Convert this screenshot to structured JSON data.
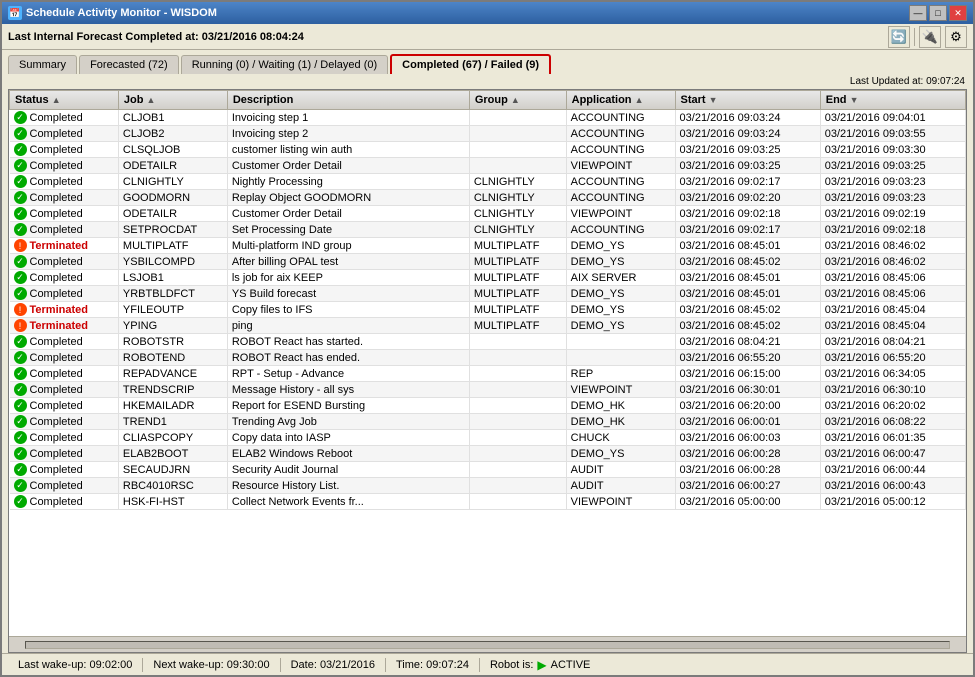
{
  "window": {
    "title": "Schedule Activity Monitor - WISDOM",
    "icon": "📅"
  },
  "title_bar": {
    "minimize": "—",
    "maximize": "□",
    "close": "✕"
  },
  "forecast": {
    "label": "Last Internal Forecast Completed at: 03/21/2016 08:04:24"
  },
  "toolbar": {
    "refresh_icon": "🔄",
    "connect_icon": "🔌",
    "settings_icon": "⚙"
  },
  "tabs": [
    {
      "label": "Summary",
      "active": false
    },
    {
      "label": "Forecasted (72)",
      "active": false
    },
    {
      "label": "Running (0) / Waiting (1) / Delayed (0)",
      "active": false
    },
    {
      "label": "Completed (67) / Failed (9)",
      "active": true
    }
  ],
  "last_updated": "Last Updated at: 09:07:24",
  "table": {
    "columns": [
      {
        "label": "Status",
        "sort": "asc"
      },
      {
        "label": "Job",
        "sort": "asc"
      },
      {
        "label": "Description",
        "sort": ""
      },
      {
        "label": "Group",
        "sort": "asc"
      },
      {
        "label": "Application",
        "sort": "asc"
      },
      {
        "label": "Start",
        "sort": "desc"
      },
      {
        "label": "End",
        "sort": "desc"
      }
    ],
    "rows": [
      {
        "status": "Completed",
        "status_type": "completed",
        "job": "CLJOB1",
        "description": "Invoicing step 1",
        "group": "",
        "application": "ACCOUNTING",
        "start": "03/21/2016 09:03:24",
        "end": "03/21/2016 09:04:01"
      },
      {
        "status": "Completed",
        "status_type": "completed",
        "job": "CLJOB2",
        "description": "Invoicing step 2",
        "group": "",
        "application": "ACCOUNTING",
        "start": "03/21/2016 09:03:24",
        "end": "03/21/2016 09:03:55"
      },
      {
        "status": "Completed",
        "status_type": "completed",
        "job": "CLSQLJOB",
        "description": "customer listing win auth",
        "group": "",
        "application": "ACCOUNTING",
        "start": "03/21/2016 09:03:25",
        "end": "03/21/2016 09:03:30"
      },
      {
        "status": "Completed",
        "status_type": "completed",
        "job": "ODETAILR",
        "description": "Customer Order Detail",
        "group": "",
        "application": "VIEWPOINT",
        "start": "03/21/2016 09:03:25",
        "end": "03/21/2016 09:03:25"
      },
      {
        "status": "Completed",
        "status_type": "completed",
        "job": "CLNIGHTLY",
        "description": "Nightly Processing",
        "group": "CLNIGHTLY",
        "application": "ACCOUNTING",
        "start": "03/21/2016 09:02:17",
        "end": "03/21/2016 09:03:23"
      },
      {
        "status": "Completed",
        "status_type": "completed",
        "job": "GOODMORN",
        "description": "Replay Object GOODMORN",
        "group": "CLNIGHTLY",
        "application": "ACCOUNTING",
        "start": "03/21/2016 09:02:20",
        "end": "03/21/2016 09:03:23"
      },
      {
        "status": "Completed",
        "status_type": "completed",
        "job": "ODETAILR",
        "description": "Customer Order Detail",
        "group": "CLNIGHTLY",
        "application": "VIEWPOINT",
        "start": "03/21/2016 09:02:18",
        "end": "03/21/2016 09:02:19"
      },
      {
        "status": "Completed",
        "status_type": "completed",
        "job": "SETPROCDAT",
        "description": "Set Processing Date",
        "group": "CLNIGHTLY",
        "application": "ACCOUNTING",
        "start": "03/21/2016 09:02:17",
        "end": "03/21/2016 09:02:18"
      },
      {
        "status": "Terminated",
        "status_type": "terminated",
        "job": "MULTIPLATF",
        "description": "Multi-platform IND group",
        "group": "MULTIPLATF",
        "application": "DEMO_YS",
        "start": "03/21/2016 08:45:01",
        "end": "03/21/2016 08:46:02"
      },
      {
        "status": "Completed",
        "status_type": "completed",
        "job": "YSBILCOMPD",
        "description": "After billing OPAL test",
        "group": "MULTIPLATF",
        "application": "DEMO_YS",
        "start": "03/21/2016 08:45:02",
        "end": "03/21/2016 08:46:02"
      },
      {
        "status": "Completed",
        "status_type": "completed",
        "job": "LSJOB1",
        "description": "ls job for aix KEEP",
        "group": "MULTIPLATF",
        "application": "AIX SERVER",
        "start": "03/21/2016 08:45:01",
        "end": "03/21/2016 08:45:06"
      },
      {
        "status": "Completed",
        "status_type": "completed",
        "job": "YRBTBLDFCT",
        "description": "YS Build forecast",
        "group": "MULTIPLATF",
        "application": "DEMO_YS",
        "start": "03/21/2016 08:45:01",
        "end": "03/21/2016 08:45:06"
      },
      {
        "status": "Terminated",
        "status_type": "terminated",
        "job": "YFILEOUTP",
        "description": "Copy files to IFS",
        "group": "MULTIPLATF",
        "application": "DEMO_YS",
        "start": "03/21/2016 08:45:02",
        "end": "03/21/2016 08:45:04"
      },
      {
        "status": "Terminated",
        "status_type": "terminated",
        "job": "YPING",
        "description": "ping",
        "group": "MULTIPLATF",
        "application": "DEMO_YS",
        "start": "03/21/2016 08:45:02",
        "end": "03/21/2016 08:45:04"
      },
      {
        "status": "Completed",
        "status_type": "completed",
        "job": "ROBOTSTR",
        "description": "ROBOT React has started.",
        "group": "",
        "application": "",
        "start": "03/21/2016 08:04:21",
        "end": "03/21/2016 08:04:21"
      },
      {
        "status": "Completed",
        "status_type": "completed",
        "job": "ROBOTEND",
        "description": "ROBOT React has ended.",
        "group": "",
        "application": "",
        "start": "03/21/2016 06:55:20",
        "end": "03/21/2016 06:55:20"
      },
      {
        "status": "Completed",
        "status_type": "completed",
        "job": "REPADVANCE",
        "description": "RPT - Setup - Advance",
        "group": "",
        "application": "REP",
        "start": "03/21/2016 06:15:00",
        "end": "03/21/2016 06:34:05"
      },
      {
        "status": "Completed",
        "status_type": "completed",
        "job": "TRENDSCRIP",
        "description": "Message History - all sys",
        "group": "",
        "application": "VIEWPOINT",
        "start": "03/21/2016 06:30:01",
        "end": "03/21/2016 06:30:10"
      },
      {
        "status": "Completed",
        "status_type": "completed",
        "job": "HKEMAILADR",
        "description": "Report for ESEND Bursting",
        "group": "",
        "application": "DEMO_HK",
        "start": "03/21/2016 06:20:00",
        "end": "03/21/2016 06:20:02"
      },
      {
        "status": "Completed",
        "status_type": "completed",
        "job": "TREND1",
        "description": "Trending Avg Job",
        "group": "",
        "application": "DEMO_HK",
        "start": "03/21/2016 06:00:01",
        "end": "03/21/2016 06:08:22"
      },
      {
        "status": "Completed",
        "status_type": "completed",
        "job": "CLIASPCOPY",
        "description": "Copy data into IASP",
        "group": "",
        "application": "CHUCK",
        "start": "03/21/2016 06:00:03",
        "end": "03/21/2016 06:01:35"
      },
      {
        "status": "Completed",
        "status_type": "completed",
        "job": "ELAB2BOOT",
        "description": "ELAB2 Windows Reboot",
        "group": "",
        "application": "DEMO_YS",
        "start": "03/21/2016 06:00:28",
        "end": "03/21/2016 06:00:47"
      },
      {
        "status": "Completed",
        "status_type": "completed",
        "job": "SECAUDJRN",
        "description": "Security Audit Journal",
        "group": "",
        "application": "AUDIT",
        "start": "03/21/2016 06:00:28",
        "end": "03/21/2016 06:00:44"
      },
      {
        "status": "Completed",
        "status_type": "completed",
        "job": "RBC4010RSC",
        "description": "Resource History List.",
        "group": "",
        "application": "AUDIT",
        "start": "03/21/2016 06:00:27",
        "end": "03/21/2016 06:00:43"
      },
      {
        "status": "Completed",
        "status_type": "completed",
        "job": "HSK-FI-HST",
        "description": "Collect Network Events fr...",
        "group": "",
        "application": "VIEWPOINT",
        "start": "03/21/2016 05:00:00",
        "end": "03/21/2016 05:00:12"
      }
    ]
  },
  "status_bar": {
    "last_wakeup_label": "Last wake-up:",
    "last_wakeup_value": "09:02:00",
    "next_wakeup_label": "Next wake-up:",
    "next_wakeup_value": "09:30:00",
    "date_label": "Date:",
    "date_value": "03/21/2016",
    "time_label": "Time:",
    "time_value": "09:07:24",
    "robot_label": "Robot is:",
    "robot_value": "ACTIVE"
  }
}
